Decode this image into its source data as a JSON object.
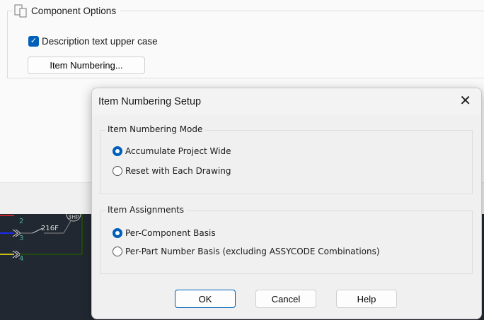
{
  "background": {
    "group_title": "Component Options",
    "checkbox_label": "Description text upper case",
    "checkbox_checked": true,
    "item_numbering_button": "Item Numbering...",
    "canvas_labels": {
      "wire2": "2",
      "wire3": "3",
      "wire4": "4",
      "switch": "216F",
      "motor": "3HP"
    }
  },
  "dialog": {
    "title": "Item Numbering Setup",
    "close_icon": "close-icon",
    "mode_group": {
      "title": "Item Numbering Mode",
      "options": [
        {
          "label": "Accumulate Project Wide",
          "selected": true
        },
        {
          "label": "Reset with Each Drawing",
          "selected": false
        }
      ]
    },
    "assign_group": {
      "title": "Item Assignments",
      "options": [
        {
          "label": "Per-Component Basis",
          "selected": true
        },
        {
          "label": "Per-Part Number Basis (excluding ASSYCODE Combinations)",
          "selected": false
        }
      ]
    },
    "buttons": {
      "ok": "OK",
      "cancel": "Cancel",
      "help": "Help"
    }
  },
  "colors": {
    "accent": "#005fb8",
    "canvas": "#222831"
  }
}
